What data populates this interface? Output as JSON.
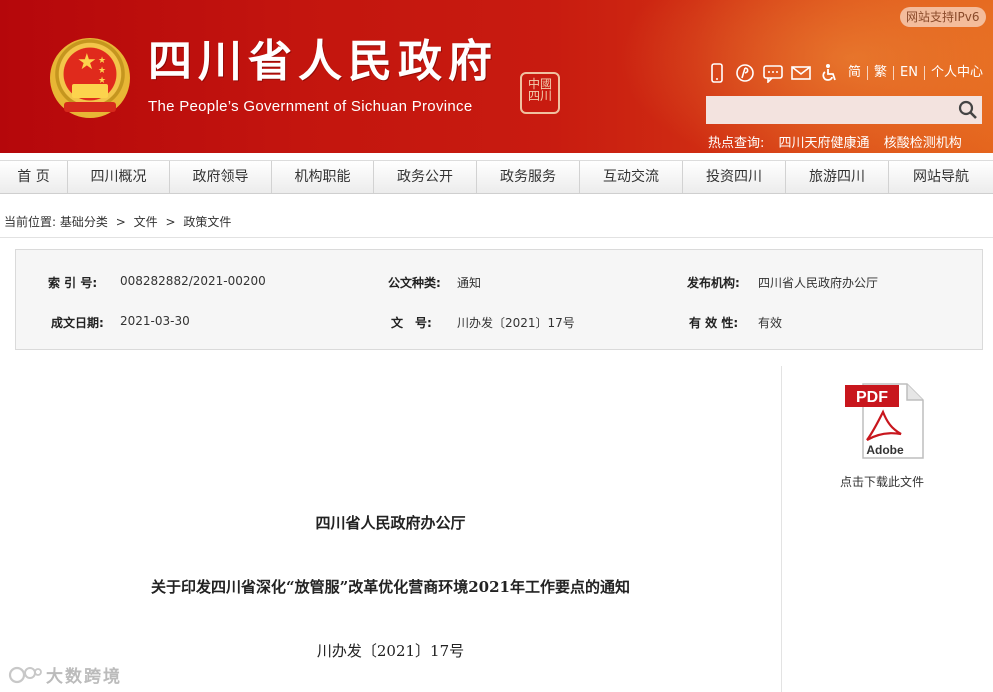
{
  "header": {
    "site_title": "四川省人民政府",
    "site_subtitle": "The People’s Government of Sichuan Province",
    "seal_text": "中國四川",
    "ipv6_badge": "网站支持IPv6",
    "tool_icons": [
      "mobile-icon",
      "weibo-icon",
      "chat-icon",
      "mail-icon",
      "accessibility-icon"
    ],
    "lang_links": [
      "简",
      "繁",
      "EN",
      "个人中心"
    ],
    "search_placeholder": "",
    "hot_label": "热点查询:",
    "hot_links": [
      "四川天府健康通",
      "核酸检测机构"
    ]
  },
  "nav": {
    "items": [
      "首 页",
      "四川概况",
      "政府领导",
      "机构职能",
      "政务公开",
      "政务服务",
      "互动交流",
      "投资四川",
      "旅游四川",
      "网站导航"
    ]
  },
  "breadcrumb": {
    "label": "当前位置:",
    "items": [
      "基础分类",
      "文件",
      "政策文件"
    ],
    "separator": ">"
  },
  "info": {
    "index_label": "索 引 号:",
    "index_value": "008282882/2021-00200",
    "type_label": "公文种类:",
    "type_value": "通知",
    "issuer_label": "发布机构:",
    "issuer_value": "四川省人民政府办公厅",
    "date_label": "成文日期:",
    "date_value": "2021-03-30",
    "docno_label": "文　号:",
    "docno_value": "川办发〔2021〕17号",
    "validity_label": "有 效 性:",
    "validity_value": "有效"
  },
  "download": {
    "pdf_label": "PDF",
    "adobe_label": "Adobe",
    "caption": "点击下载此文件"
  },
  "document": {
    "org": "四川省人民政府办公厅",
    "title": "关于印发四川省深化“放管服”改革优化营商环境2021年工作要点的通知",
    "number": "川办发〔2021〕17号"
  },
  "watermark": {
    "text": "大数跨境"
  }
}
